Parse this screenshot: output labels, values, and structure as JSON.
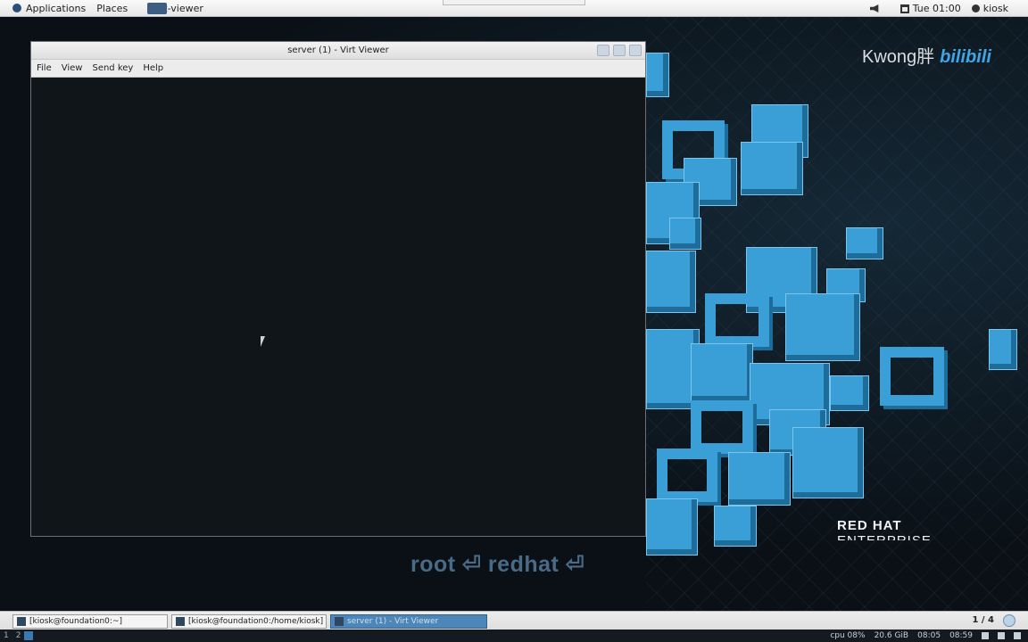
{
  "top_panel": {
    "applications_label": "Applications",
    "places_label": "Places",
    "window_label": "virt-viewer",
    "clock": "Tue 01:00",
    "user": "kiosk"
  },
  "desktop": {
    "watermark_name": "Kwong胖",
    "watermark_brand": "bilibili",
    "brand_line1": "RED HAT",
    "brand_line2": "ENTERPRISE",
    "caption": "root ⏎ redhat ⏎"
  },
  "viewer": {
    "title": "server (1) - Virt Viewer",
    "menu": [
      "File",
      "View",
      "Send key",
      "Help"
    ]
  },
  "taskbar": {
    "tasks": [
      "[kiosk@foundation0:~]",
      "[kiosk@foundation0:/home/kiosk]",
      "server (1) - Virt Viewer"
    ],
    "workspace": "1 / 4"
  },
  "status": {
    "workspaces": [
      "1",
      "2"
    ],
    "cpu": "cpu 08%",
    "mem": "20.6 GiB",
    "time_a": "08:05",
    "time_b": "08:59"
  },
  "colors": {
    "accent": "#3a9fd6",
    "panel": "#e6e6e6",
    "viewer_bg": "#0f1519"
  }
}
